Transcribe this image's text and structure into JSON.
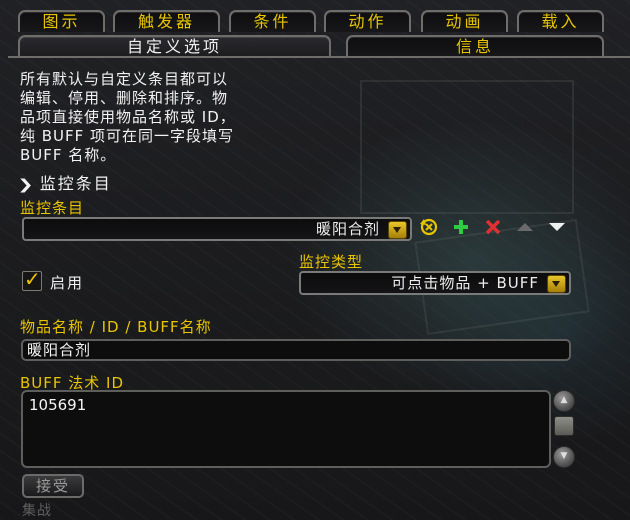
{
  "tabs_top": [
    {
      "label": "图示"
    },
    {
      "label": "触发器"
    },
    {
      "label": "条件"
    },
    {
      "label": "动作"
    },
    {
      "label": "动画"
    },
    {
      "label": "载入"
    }
  ],
  "tabs_sub": [
    {
      "label": "自定义选项",
      "active": true
    },
    {
      "label": "信息",
      "active": false
    }
  ],
  "description": [
    "所有默认与自定义条目都可以",
    "编辑、停用、删除和排序。物",
    "品项直接使用物品名称或 ID，",
    "纯 BUFF 项可在同一字段填写",
    "BUFF 名称。"
  ],
  "section_toggle": {
    "icon": "chevron-down-icon",
    "label": "监控条目"
  },
  "monitor_entry": {
    "label": "监控条目",
    "selected": "暖阳合剂"
  },
  "entry_actions": [
    {
      "name": "reset-icon",
      "color": "#e8c500"
    },
    {
      "name": "add-icon",
      "color": "#2ecc40"
    },
    {
      "name": "delete-icon",
      "color": "#e03030"
    },
    {
      "name": "move-up-icon",
      "color": "#6a6a6a"
    },
    {
      "name": "move-down-icon",
      "color": "#f0f0f0"
    }
  ],
  "enabled": {
    "label": "启用",
    "checked": true
  },
  "monitor_type": {
    "label": "监控类型",
    "selected": "可点击物品 + BUFF"
  },
  "item_name": {
    "label": "物品名称 / ID / BUFF名称",
    "value": "暖阳合剂"
  },
  "buff_spell": {
    "label": "BUFF 法术 ID",
    "value": "105691"
  },
  "accept_button": {
    "label": "接受"
  },
  "bottom_faded_text": "集战",
  "colors": {
    "accent": "#e8c500",
    "text": "#f2f2f2",
    "background": "#1b1b1e"
  }
}
